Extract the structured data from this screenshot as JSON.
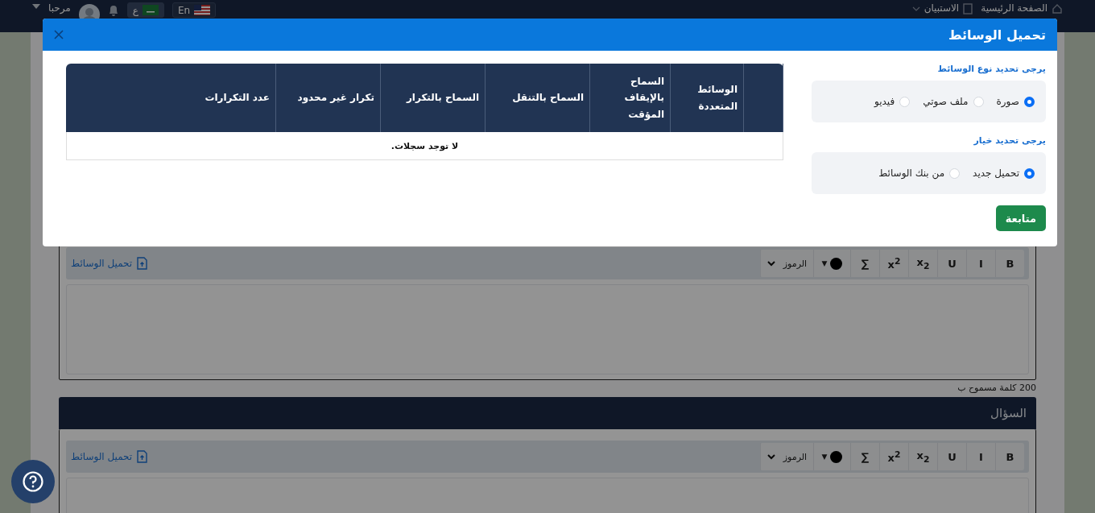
{
  "nav": {
    "home": "الصفحة الرئيسية",
    "survey": "الاستبيان",
    "lang_en": "En",
    "lang_ar": "ع",
    "greeting": "مرحبا"
  },
  "editors": [
    {
      "toolbar": [
        {
          "kind": "text",
          "label": "B"
        },
        {
          "kind": "text",
          "label": "I"
        },
        {
          "kind": "text",
          "label": "U"
        },
        {
          "kind": "text",
          "label": "x$_{2}$"
        },
        {
          "kind": "text",
          "label": "x$^{2}$"
        },
        {
          "kind": "text",
          "label": "∑"
        },
        {
          "kind": "color",
          "label": "▼"
        },
        {
          "kind": "symbols",
          "label": "الرموز"
        }
      ],
      "upload": "تحميل الوسائط",
      "word_limit": "200 كلمة مسموح ب"
    },
    {
      "title": "السؤال",
      "toolbar": [
        {
          "kind": "text",
          "label": "B"
        },
        {
          "kind": "text",
          "label": "I"
        },
        {
          "kind": "text",
          "label": "U"
        },
        {
          "kind": "text",
          "label": "x$_{2}$"
        },
        {
          "kind": "text",
          "label": "x$^{2}$"
        },
        {
          "kind": "text",
          "label": "∑"
        },
        {
          "kind": "color",
          "label": "▼"
        },
        {
          "kind": "symbols",
          "label": "الرموز"
        }
      ],
      "upload": "تحميل الوسائط"
    }
  ],
  "modal": {
    "title": "تحميل الوسائط",
    "groups": [
      {
        "label": "يرجى تحديد نوع الوسائط",
        "options": [
          {
            "label": "صورة",
            "selected": true
          },
          {
            "label": "ملف صوتي",
            "selected": false
          },
          {
            "label": "فيديو",
            "selected": false
          }
        ]
      },
      {
        "label": "يرجى تحديد خيار",
        "options": [
          {
            "label": "تحميل جديد",
            "selected": true
          },
          {
            "label": "من بنك الوسائط",
            "selected": false
          }
        ]
      }
    ],
    "continue": "متابعة",
    "table": {
      "columns": [
        "الوسائط المتعددة",
        "السماح بالإيقاف المؤقت",
        "السماح بالتنقل",
        "السماح بالتكرار",
        "تكرار غير محدود",
        "عدد التكرارات"
      ],
      "empty": "لا توجد سجلات."
    }
  }
}
